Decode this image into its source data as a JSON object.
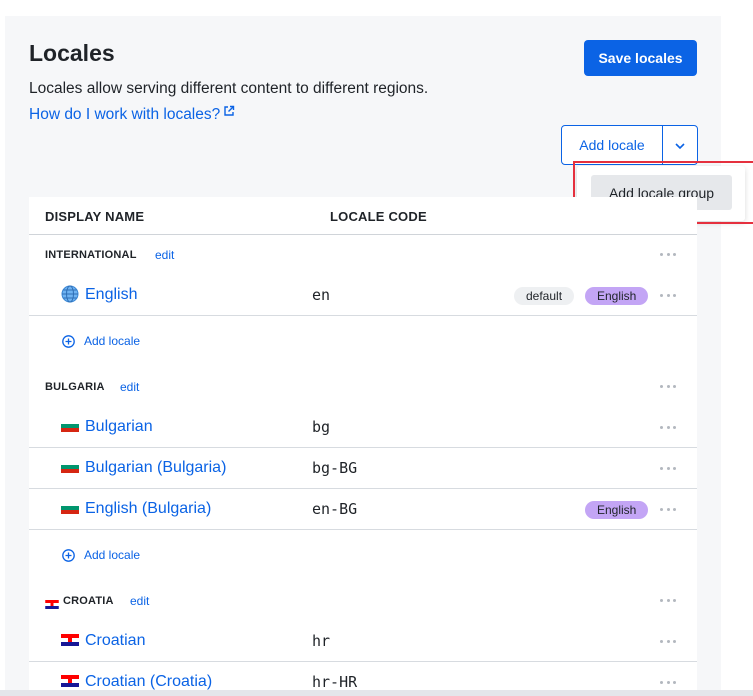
{
  "header": {
    "title": "Locales",
    "subtitle": "Locales allow serving different content to different regions.",
    "help_link": "How do I work with locales?"
  },
  "actions": {
    "save_label": "Save locales",
    "add_locale_label": "Add locale",
    "dropdown_item": "Add locale group"
  },
  "table": {
    "col_display_name": "DISPLAY NAME",
    "col_locale_code": "LOCALE CODE",
    "edit_label": "edit",
    "add_locale_label": "Add locale",
    "default_badge": "default",
    "groups": [
      {
        "name": "INTERNATIONAL",
        "locales": [
          {
            "name": "English",
            "code": "en",
            "flag": "globe-icon",
            "default": true,
            "language": "English"
          }
        ]
      },
      {
        "name": "BULGARIA",
        "locales": [
          {
            "name": "Bulgarian",
            "code": "bg",
            "flag": "bulgaria-flag-icon"
          },
          {
            "name": "Bulgarian (Bulgaria)",
            "code": "bg-BG",
            "flag": "bulgaria-flag-icon"
          },
          {
            "name": "English (Bulgaria)",
            "code": "en-BG",
            "flag": "bulgaria-flag-icon",
            "language": "English"
          }
        ]
      },
      {
        "name": "CROATIA",
        "locales": [
          {
            "name": "Croatian",
            "code": "hr",
            "flag": "croatia-flag-icon"
          },
          {
            "name": "Croatian (Croatia)",
            "code": "hr-HR",
            "flag": "croatia-flag-icon"
          }
        ]
      }
    ]
  },
  "colors": {
    "accent": "#0b63e5",
    "language_badge": "#c3a5f5",
    "highlight": "#e5303e"
  }
}
